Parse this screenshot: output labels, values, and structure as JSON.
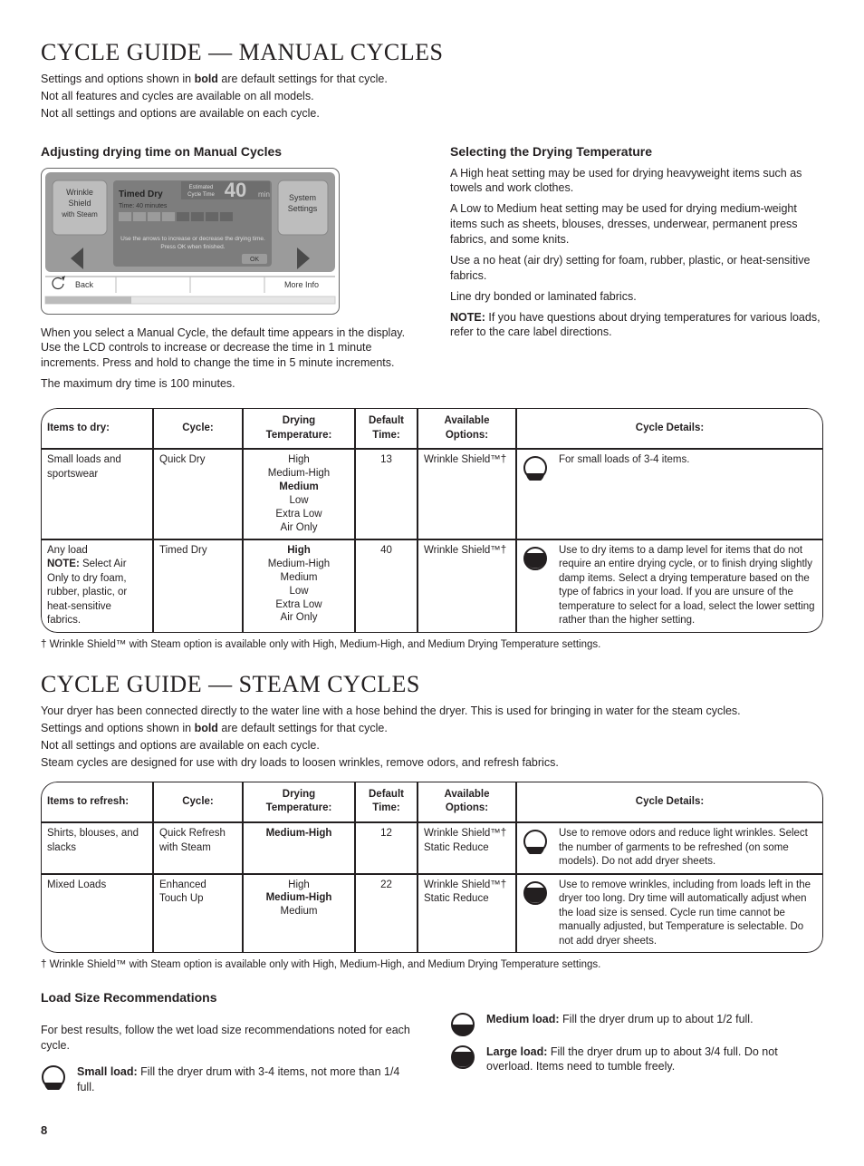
{
  "manual": {
    "title": "CYCLE GUIDE — MANUAL CYCLES",
    "intro1_pre": "Settings and options shown in ",
    "intro1_bold": "bold",
    "intro1_post": " are default settings for that cycle.",
    "intro2": "Not all features and cycles are available on all models.",
    "intro3": "Not all settings and options are available on each cycle.",
    "left_heading": "Adjusting drying time on Manual Cycles",
    "lcd": {
      "wrinkle1": "Wrinkle",
      "wrinkle2": "Shield",
      "wrinkle3": "with Steam",
      "timed_dry": "Timed Dry",
      "time_40": "Time: 40 minutes",
      "est1": "Estimated",
      "est2": "Cycle Time",
      "est_num": "40",
      "est_min": "min",
      "hint1": "Use the arrows to increase or decrease the drying time.",
      "hint2": "Press OK when finished.",
      "ok": "OK",
      "sys1": "System",
      "sys2": "Settings",
      "back": "Back",
      "more": "More Info"
    },
    "left_p1": "When you select a Manual Cycle, the default time appears in the display. Use the LCD controls to increase or decrease the time in 1 minute increments. Press and hold to change the time in 5 minute increments.",
    "left_p2": "The maximum dry time is 100 minutes.",
    "right_heading": "Selecting the Drying Temperature",
    "right_p1": "A High heat setting may be used for drying heavyweight items such as towels and work clothes.",
    "right_p2": "A Low to Medium heat setting may be used for drying medium-weight items such as sheets, blouses, dresses, underwear, permanent press fabrics, and some knits.",
    "right_p3": "Use a no heat (air dry) setting for foam, rubber, plastic, or heat-sensitive fabrics.",
    "right_p4": "Line dry bonded or laminated fabrics.",
    "right_p5_bold": "NOTE:",
    "right_p5": " If you have questions about drying temperatures for various loads, refer to the care label directions.",
    "table": {
      "headers": [
        "Items to dry:",
        "Cycle:",
        "Drying Temperature:",
        "Default Time:",
        "Available Options:",
        "Cycle Details:"
      ],
      "rows": [
        {
          "items": "Small loads and sportswear",
          "cycle": "Quick Dry",
          "temps": [
            "High",
            "Medium-High",
            "Medium",
            "Low",
            "Extra Low",
            "Air Only"
          ],
          "default_temp": "Medium",
          "time": "13",
          "options": "Wrinkle Shield™†",
          "load": "small",
          "details": "For small loads of 3-4 items."
        },
        {
          "items_pre": "Any load",
          "items_bold": "NOTE:",
          "items_post": " Select Air Only to dry foam, rubber, plastic, or heat-sensitive fabrics.",
          "cycle": "Timed Dry",
          "temps": [
            "High",
            "Medium-High",
            "Medium",
            "Low",
            "Extra Low",
            "Air Only"
          ],
          "default_temp": "High",
          "time": "40",
          "options": "Wrinkle Shield™†",
          "load": "large",
          "details": "Use to dry items to a damp level for items that do not require an entire drying cycle, or to finish drying slightly damp items. Select a drying temperature based on the type of fabrics in your load. If you are unsure of the temperature to select for a load, select the lower setting rather than the higher setting."
        }
      ]
    },
    "footnote": "†  Wrinkle Shield™ with Steam option is available only with High, Medium-High, and Medium Drying Temperature settings."
  },
  "steam": {
    "title": "CYCLE GUIDE — STEAM CYCLES",
    "intro1": "Your dryer has been connected directly to the water line with a hose behind the dryer. This is used for bringing in water for the steam cycles.",
    "intro2_pre": "Settings and options shown in ",
    "intro2_bold": "bold",
    "intro2_post": " are default settings for that cycle.",
    "intro3": "Not all settings and options are available on each cycle.",
    "intro4": "Steam cycles are designed for use with dry loads to loosen wrinkles, remove odors, and refresh fabrics.",
    "table": {
      "headers": [
        "Items to refresh:",
        "Cycle:",
        "Drying Temperature:",
        "Default Time:",
        "Available Options:",
        "Cycle Details:"
      ],
      "rows": [
        {
          "items": "Shirts, blouses, and slacks",
          "cycle": "Quick Refresh with Steam",
          "temps": [
            "Medium-High"
          ],
          "default_temp": "Medium-High",
          "time": "12",
          "options": "Wrinkle Shield™†\nStatic Reduce",
          "load": "small",
          "details": "Use to remove odors and reduce light wrinkles. Select the number of garments to be refreshed (on some models). Do not add dryer sheets."
        },
        {
          "items": "Mixed Loads",
          "cycle": "Enhanced Touch Up",
          "temps": [
            "High",
            "Medium-High",
            "Medium"
          ],
          "default_temp": "Medium-High",
          "time": "22",
          "options": "Wrinkle Shield™†\nStatic Reduce",
          "load": "large",
          "details": "Use to remove wrinkles, including from loads left in the dryer too long. Dry time will automatically adjust when the load size is sensed. Cycle run time cannot be manually adjusted, but Temperature is selectable. Do not add dryer sheets."
        }
      ]
    },
    "footnote": "†  Wrinkle Shield™ with Steam option is available only with High, Medium-High, and Medium Drying Temperature settings."
  },
  "load_rec": {
    "heading": "Load Size Recommendations",
    "intro": "For best results, follow the wet load size recommendations noted for each cycle.",
    "small_bold": "Small load:",
    "small": " Fill the dryer drum with 3-4 items, not more than 1/4 full.",
    "medium_bold": "Medium load:",
    "medium": " Fill the dryer drum up to about 1/2 full.",
    "large_bold": "Large load:",
    "large": " Fill the dryer drum up to about 3/4 full. Do not overload. Items need to tumble freely."
  },
  "page": "8"
}
